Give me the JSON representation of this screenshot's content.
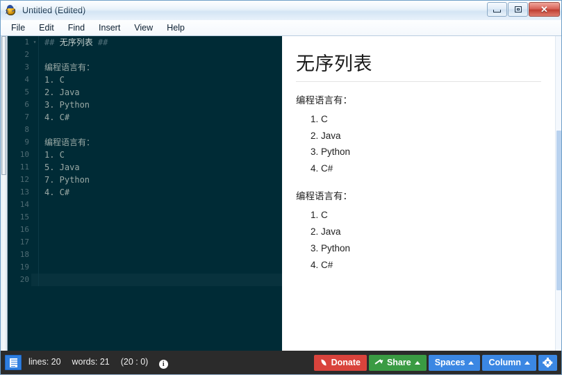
{
  "window": {
    "title": "Untitled (Edited)",
    "icon": "bug-app-icon",
    "controls": {
      "minimize": "minimize-button",
      "maximize": "maximize-button",
      "close": "close-button",
      "close_glyph": "✕"
    }
  },
  "menubar": {
    "items": [
      {
        "label": "File"
      },
      {
        "label": "Edit"
      },
      {
        "label": "Find"
      },
      {
        "label": "Insert"
      },
      {
        "label": "View"
      },
      {
        "label": "Help"
      }
    ]
  },
  "editor": {
    "fold_glyph": "▾",
    "lines": [
      {
        "num": "1",
        "fold": true,
        "mark": "## ",
        "text": "无序列表",
        "tail": " ##",
        "heading": true
      },
      {
        "num": "2",
        "fold": false,
        "text": ""
      },
      {
        "num": "3",
        "fold": false,
        "text": "编程语言有："
      },
      {
        "num": "4",
        "fold": false,
        "text": "1. C"
      },
      {
        "num": "5",
        "fold": false,
        "text": "2. Java"
      },
      {
        "num": "6",
        "fold": false,
        "text": "3. Python"
      },
      {
        "num": "7",
        "fold": false,
        "text": "4. C#"
      },
      {
        "num": "8",
        "fold": false,
        "text": ""
      },
      {
        "num": "9",
        "fold": false,
        "text": "编程语言有："
      },
      {
        "num": "10",
        "fold": false,
        "text": "1. C"
      },
      {
        "num": "11",
        "fold": false,
        "text": "5. Java"
      },
      {
        "num": "12",
        "fold": false,
        "text": "7. Python"
      },
      {
        "num": "13",
        "fold": false,
        "text": "4. C#"
      },
      {
        "num": "14",
        "fold": false,
        "text": ""
      },
      {
        "num": "15",
        "fold": false,
        "text": ""
      },
      {
        "num": "16",
        "fold": false,
        "text": ""
      },
      {
        "num": "17",
        "fold": false,
        "text": ""
      },
      {
        "num": "18",
        "fold": false,
        "text": ""
      },
      {
        "num": "19",
        "fold": false,
        "text": ""
      },
      {
        "num": "20",
        "fold": false,
        "text": "",
        "cursor": true
      }
    ]
  },
  "preview": {
    "heading": "无序列表",
    "blocks": [
      {
        "paragraph": "编程语言有：",
        "items": [
          "C",
          "Java",
          "Python",
          "C#"
        ]
      },
      {
        "paragraph": "编程语言有：",
        "items": [
          "C",
          "Java",
          "Python",
          "C#"
        ]
      }
    ]
  },
  "statusbar": {
    "lines_label": "lines: 20",
    "words_label": "words: 21",
    "position_label": "(20 : 0)",
    "info_glyph": "i",
    "buttons": {
      "donate": "Donate",
      "share": "Share",
      "spaces": "Spaces",
      "column": "Column",
      "settings": "settings-gear"
    }
  },
  "colors": {
    "editor_bg": "#002b36",
    "editor_cursor_line": "#08323d",
    "editor_text": "#9aa9a5",
    "editor_gutter_text": "#4e6b73",
    "donate_red": "#d9433c",
    "share_green": "#3a9b43",
    "blue": "#3b87e3",
    "statusbar_bg": "#2b2b2b"
  }
}
